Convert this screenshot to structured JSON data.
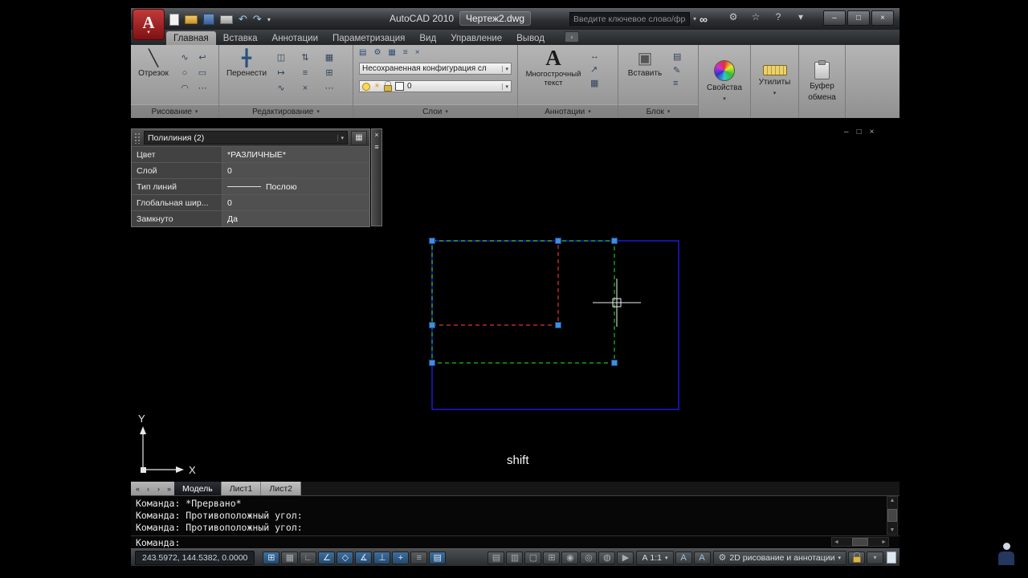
{
  "ui": {
    "dropdown_glyph": "▾",
    "up_glyph": "▲",
    "down_glyph": "▼",
    "left_glyph": "◄",
    "right_glyph": "►"
  },
  "titlebar": {
    "app_logo_letter": "A",
    "app_title": "AutoCAD 2010",
    "doc_title": "Чертеж2.dwg",
    "search": {
      "placeholder": "Введите ключевое слово/фразу",
      "search_icon_glyph": "∞"
    },
    "qat_icons": [
      {
        "name": "new-file-icon"
      },
      {
        "name": "open-file-icon"
      },
      {
        "name": "save-icon"
      },
      {
        "name": "plot-icon"
      },
      {
        "name": "undo-icon",
        "glyph": "↶"
      },
      {
        "name": "redo-icon",
        "glyph": "↷"
      },
      {
        "name": "qat-options-icon",
        "glyph": "▾"
      }
    ],
    "infocenter_icons": [
      {
        "name": "communication-center-icon",
        "glyph": "⚙"
      },
      {
        "name": "favorites-icon",
        "glyph": "☆"
      },
      {
        "name": "help-icon",
        "glyph": "?"
      },
      {
        "name": "help-dropdown-icon",
        "glyph": "▾"
      }
    ],
    "window_buttons": {
      "minimize": "‒",
      "maximize": "□",
      "close": "×"
    }
  },
  "ribbon": {
    "overflow_glyph": "▫",
    "tabs": [
      {
        "label": "Главная",
        "active": true
      },
      {
        "label": "Вставка"
      },
      {
        "label": "Аннотации"
      },
      {
        "label": "Параметризация"
      },
      {
        "label": "Вид"
      },
      {
        "label": "Управление"
      },
      {
        "label": "Вывод"
      }
    ],
    "panels": {
      "draw": {
        "label": "Рисование",
        "big_button": "Отрезок",
        "line_icon_glyph": "╲",
        "small_icons": [
          "∿",
          "↩",
          "○",
          "▭",
          "◠",
          "⋯"
        ]
      },
      "modify": {
        "label": "Редактирование",
        "big_button": "Перенести",
        "move_icon_glyph": "╋",
        "small_icons": [
          "◫",
          "⇅",
          "▦",
          "↦",
          "≡",
          "⊞",
          "∿",
          "×",
          "⋯"
        ]
      },
      "layers": {
        "label": "Слои",
        "toolbar_icons": [
          "▤",
          "⚙",
          "▦",
          "≡",
          "×"
        ],
        "config_dropdown": "Несохраненная конфигурация сл",
        "layer_value": "0"
      },
      "annotation": {
        "label": "Аннотации",
        "big_glyph": "А",
        "big_button_line1": "Многострочный",
        "big_button_line2": "текст",
        "side_icons": [
          "↔",
          "↗",
          "▦"
        ]
      },
      "block": {
        "label": "Блок",
        "big_button": "Вставить",
        "block_icon_glyph": "▣",
        "side_icons": [
          "▤",
          "✎",
          "≡"
        ]
      },
      "properties": {
        "label": "Свойства"
      },
      "utilities": {
        "label": "Утилиты"
      },
      "clipboard": {
        "label_line1": "Буфер",
        "label_line2": "обмена"
      }
    }
  },
  "quick_properties": {
    "selector": "Полилиния (2)",
    "header_icons": {
      "settings_glyph": "▦",
      "close_glyph": "×",
      "options_glyph": "≡"
    },
    "rows": [
      {
        "label": "Цвет",
        "value": "*РАЗЛИЧНЫЕ*"
      },
      {
        "label": "Слой",
        "value": "0"
      },
      {
        "label": "Тип линий",
        "value": "Послою"
      },
      {
        "label": "Глобальная шир...",
        "value": "0"
      },
      {
        "label": "Замкнуто",
        "value": "Да"
      }
    ]
  },
  "drawing": {
    "shift_label": "shift",
    "axis_x_label": "X",
    "axis_y_label": "Y",
    "doc_window_buttons": {
      "minimize": "‒",
      "restore": "□",
      "close": "×"
    },
    "colors": {
      "shape_blue": "#1b1bd4",
      "selection_green": "#17c417",
      "reference_red": "#e03232",
      "grip_fill": "#3f8fdf",
      "grip_border": "#16457f",
      "crosshair": "#f0f0f0"
    }
  },
  "layout_tabs": {
    "nav_icons": [
      "«",
      "‹",
      "›",
      "»"
    ],
    "tabs": [
      {
        "label": "Модель",
        "active": true
      },
      {
        "label": "Лист1",
        "active": false
      },
      {
        "label": "Лист2",
        "active": false
      }
    ]
  },
  "command_line": {
    "history": [
      "Команда: *Прервано*",
      "Команда: Противоположный угол:",
      "Команда: Противоположный угол:"
    ],
    "prompt": "Команда:"
  },
  "status_bar": {
    "coordinates": "243.5972, 144.5382, 0.0000",
    "toggles": [
      {
        "name": "snap-toggle",
        "glyph": "⊞",
        "active": true
      },
      {
        "name": "grid-toggle",
        "glyph": "▦",
        "active": false
      },
      {
        "name": "ortho-toggle",
        "glyph": "∟",
        "active": false
      },
      {
        "name": "polar-toggle",
        "glyph": "∠",
        "active": true
      },
      {
        "name": "osnap-toggle",
        "glyph": "◇",
        "active": true
      },
      {
        "name": "otrack-toggle",
        "glyph": "∡",
        "active": true
      },
      {
        "name": "ducs-toggle",
        "glyph": "⊥",
        "active": true
      },
      {
        "name": "dyn-toggle",
        "glyph": "+",
        "active": true
      },
      {
        "name": "lwt-toggle",
        "glyph": "≡",
        "active": false
      },
      {
        "name": "qp-toggle",
        "glyph": "▤",
        "active": true
      }
    ],
    "right_buttons": [
      {
        "name": "model-button",
        "glyph": "▤"
      },
      {
        "name": "layout-button",
        "glyph": "▥"
      },
      {
        "name": "quick-view-layouts-button",
        "glyph": "▢"
      },
      {
        "name": "quick-view-drawings-button",
        "glyph": "⊞"
      },
      {
        "name": "pan-button",
        "glyph": "◉"
      },
      {
        "name": "zoom-button",
        "glyph": "◎"
      },
      {
        "name": "steering-wheel-button",
        "glyph": "◍"
      },
      {
        "name": "show-motion-button",
        "glyph": "▶"
      }
    ],
    "annotation_scale": "А 1:1",
    "annotation_icons": [
      {
        "name": "annotation-visibility-icon",
        "glyph": "А"
      },
      {
        "name": "annotation-autoscale-icon",
        "glyph": "А"
      }
    ],
    "workspace": {
      "gear_glyph": "⚙",
      "label": "2D рисование и аннотации"
    }
  }
}
